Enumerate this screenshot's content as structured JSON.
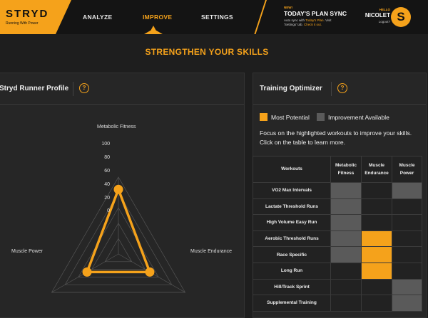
{
  "header": {
    "brand": "STRYD",
    "tagline": "Running With Power",
    "nav": [
      {
        "label": "ANALYZE",
        "active": false
      },
      {
        "label": "IMPROVE",
        "active": true
      },
      {
        "label": "SETTINGS",
        "active": false
      }
    ],
    "promo": {
      "badge": "NEW!",
      "title": "TODAY'S PLAN SYNC",
      "line1_a": "Auto sync with ",
      "line1_link": "Today's Plan",
      "line1_b": ". Visit",
      "line2_a": "'Settings' tab. ",
      "line2_link": "Check it out."
    },
    "user": {
      "hello": "HELLO",
      "name": "NICOLET",
      "logout": "Logout?",
      "avatar_letter": "S"
    }
  },
  "section_title": "STRENGTHEN YOUR SKILLS",
  "profile_card": {
    "title": "Stryd Runner Profile",
    "help": "?",
    "radar": {
      "axes": [
        "Metabolic Fitness",
        "Muscle Endurance",
        "Muscle Power"
      ],
      "ticks": [
        "100",
        "80",
        "60",
        "40",
        "20",
        "0"
      ],
      "values": [
        84,
        47,
        47
      ],
      "range": [
        0,
        100
      ],
      "color": "#f5a21b"
    }
  },
  "optimizer_card": {
    "title": "Training Optimizer",
    "help": "?",
    "legend": [
      {
        "label": "Most Potential",
        "color": "#f5a21b"
      },
      {
        "label": "Improvement Available",
        "color": "#5a5a5a"
      }
    ],
    "description": "Focus on the highlighted workouts to improve your skills. Click on the table to learn more.",
    "table": {
      "header": "Workouts",
      "columns": [
        [
          "Metabolic",
          "Fitness"
        ],
        [
          "Muscle",
          "Endurance"
        ],
        [
          "Muscle",
          "Power"
        ]
      ],
      "rows": [
        {
          "name": "VO2 Max Intervals",
          "cells": [
            "imp",
            "",
            "imp"
          ]
        },
        {
          "name": "Lactate Threshold Runs",
          "cells": [
            "imp",
            "",
            ""
          ]
        },
        {
          "name": "High Volume Easy Run",
          "cells": [
            "imp",
            "",
            ""
          ]
        },
        {
          "name": "Aerobic Threshold Runs",
          "cells": [
            "imp",
            "most",
            ""
          ]
        },
        {
          "name": "Race Specific",
          "cells": [
            "imp",
            "most",
            ""
          ]
        },
        {
          "name": "Long Run",
          "cells": [
            "",
            "most",
            ""
          ]
        },
        {
          "name": "Hill/Track Sprint",
          "cells": [
            "",
            "",
            "imp"
          ]
        },
        {
          "name": "Supplemental Training",
          "cells": [
            "",
            "",
            "imp"
          ]
        }
      ]
    }
  },
  "colors": {
    "accent": "#f5a21b",
    "improvement": "#5a5a5a",
    "background": "#1e1e1e",
    "card": "#262626"
  }
}
